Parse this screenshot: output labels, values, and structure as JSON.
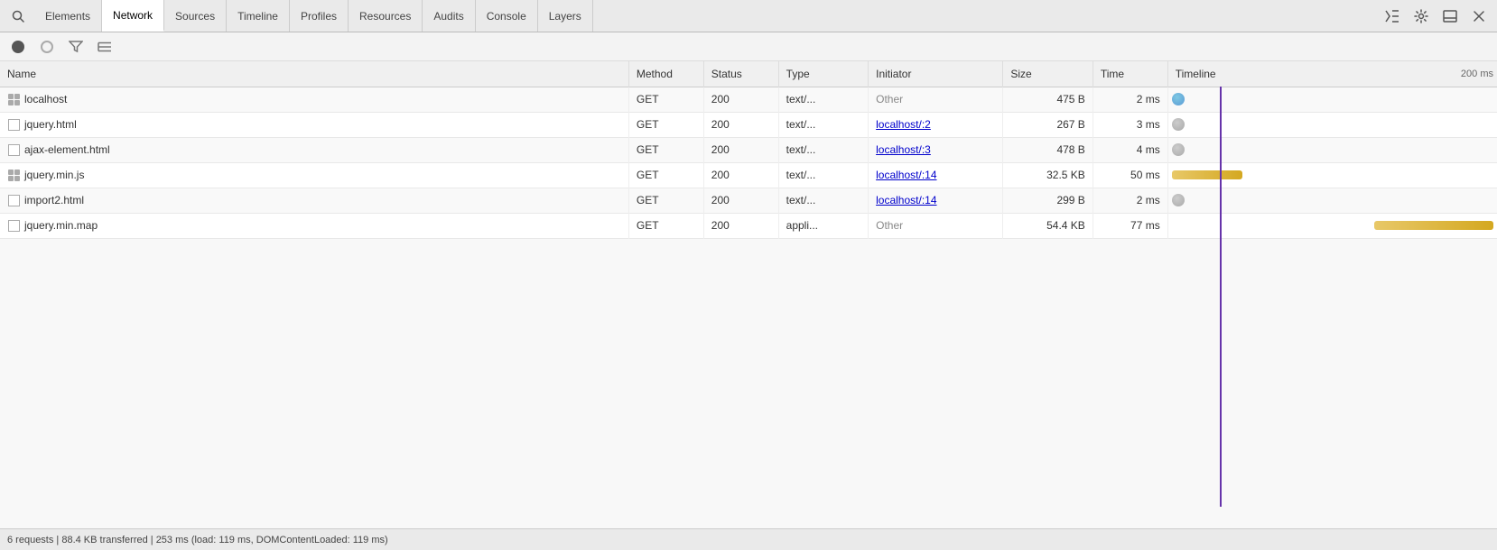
{
  "toolbar": {
    "tabs": [
      {
        "id": "elements",
        "label": "Elements",
        "active": false
      },
      {
        "id": "network",
        "label": "Network",
        "active": true
      },
      {
        "id": "sources",
        "label": "Sources",
        "active": false
      },
      {
        "id": "timeline",
        "label": "Timeline",
        "active": false
      },
      {
        "id": "profiles",
        "label": "Profiles",
        "active": false
      },
      {
        "id": "resources",
        "label": "Resources",
        "active": false
      },
      {
        "id": "audits",
        "label": "Audits",
        "active": false
      },
      {
        "id": "console",
        "label": "Console",
        "active": false
      },
      {
        "id": "layers",
        "label": "Layers",
        "active": false
      }
    ],
    "right_buttons": [
      "execute-icon",
      "settings-icon",
      "dock-icon",
      "close-icon"
    ]
  },
  "subtoolbar": {
    "icons": [
      "record",
      "stop",
      "filter",
      "list"
    ]
  },
  "table": {
    "columns": [
      "Name",
      "Method",
      "Status",
      "Type",
      "Initiator",
      "Size",
      "Time",
      "Timeline"
    ],
    "timeline_marker": "200 ms",
    "rows": [
      {
        "name": "localhost",
        "icon": "grid",
        "method": "GET",
        "status": "200",
        "type": "text/...",
        "initiator": "Other",
        "initiator_type": "other",
        "size": "475 B",
        "time": "2 ms",
        "tl_type": "circle",
        "tl_color": "blue",
        "tl_left_pct": 0,
        "tl_width_pct": 0
      },
      {
        "name": "jquery.html",
        "icon": "checkbox",
        "method": "GET",
        "status": "200",
        "type": "text/...",
        "initiator": "localhost/:2",
        "initiator_type": "link",
        "size": "267 B",
        "time": "3 ms",
        "tl_type": "circle",
        "tl_color": "gray",
        "tl_left_pct": 0,
        "tl_width_pct": 0
      },
      {
        "name": "ajax-element.html",
        "icon": "checkbox",
        "method": "GET",
        "status": "200",
        "type": "text/...",
        "initiator": "localhost/:3",
        "initiator_type": "link",
        "size": "478 B",
        "time": "4 ms",
        "tl_type": "circle",
        "tl_color": "gray",
        "tl_left_pct": 0,
        "tl_width_pct": 0
      },
      {
        "name": "jquery.min.js",
        "icon": "grid",
        "method": "GET",
        "status": "200",
        "type": "text/...",
        "initiator": "localhost/:14",
        "initiator_type": "link",
        "size": "32.5 KB",
        "time": "50 ms",
        "tl_type": "bar",
        "tl_color": "yellow",
        "tl_left_pct": 1,
        "tl_width_pct": 22
      },
      {
        "name": "import2.html",
        "icon": "checkbox",
        "method": "GET",
        "status": "200",
        "type": "text/...",
        "initiator": "localhost/:14",
        "initiator_type": "link",
        "size": "299 B",
        "time": "2 ms",
        "tl_type": "circle",
        "tl_color": "gray",
        "tl_left_pct": 0,
        "tl_width_pct": 0
      },
      {
        "name": "jquery.min.map",
        "icon": "checkbox",
        "method": "GET",
        "status": "200",
        "type": "appli...",
        "initiator": "Other",
        "initiator_type": "other",
        "size": "54.4 KB",
        "time": "77 ms",
        "tl_type": "bar",
        "tl_color": "yellow",
        "tl_left_pct": 65,
        "tl_width_pct": 33
      }
    ]
  },
  "status_bar": {
    "text": "6 requests | 88.4 KB transferred | 253 ms (load: 119 ms, DOMContentLoaded: 119 ms)"
  }
}
